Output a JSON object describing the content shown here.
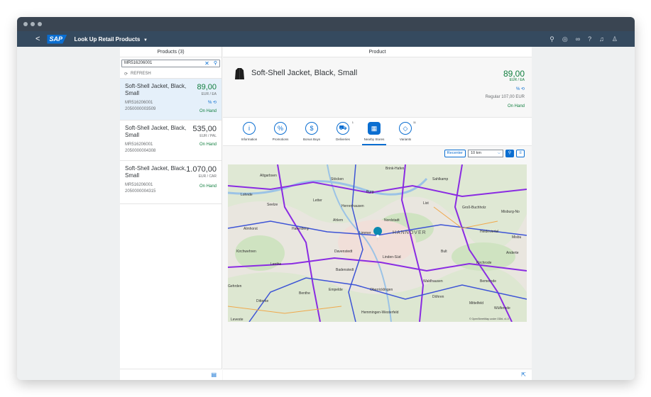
{
  "shell": {
    "back": "<",
    "logo": "SAP",
    "title": "Look Up Retail Products",
    "icons": [
      "search-icon",
      "target-icon",
      "binoculars-icon",
      "help-icon",
      "bell-icon",
      "user-icon"
    ]
  },
  "master": {
    "header": "Products (3)",
    "search_value": "MR516206001",
    "refresh": "REFRESH",
    "items": [
      {
        "name": "Soft-Shell Jacket, Black, Small",
        "price": "89,00",
        "unit": "EUR / EA",
        "sku": "MR516206001",
        "ean": "2050000003509",
        "status": "On Hand"
      },
      {
        "name": "Soft-Shell Jacket, Black, Small",
        "price": "535,00",
        "unit": "EUR / PAL",
        "sku": "MR516206001",
        "ean": "2050000004308",
        "status": "On Hand"
      },
      {
        "name": "Soft-Shell Jacket, Black, Small",
        "price": "1.070,00",
        "unit": "EUR / CAR",
        "sku": "MR516206001",
        "ean": "2050000004315",
        "status": "On Hand"
      }
    ]
  },
  "detail": {
    "header": "Product",
    "title": "Soft-Shell Jacket, Black, Small",
    "price": "89,00",
    "unit": "EUR / EA",
    "regular": "Regular 107,00 EUR",
    "status": "On Hand",
    "tabs": [
      {
        "label": "Information",
        "glyph": "i",
        "count": ""
      },
      {
        "label": "Promotions",
        "glyph": "%",
        "count": ""
      },
      {
        "label": "Bonus Buys",
        "glyph": "$",
        "count": ""
      },
      {
        "label": "Deliveries",
        "glyph": "⛟",
        "count": "1"
      },
      {
        "label": "Nearby Stores",
        "glyph": "▦",
        "count": ""
      },
      {
        "label": "Variants",
        "glyph": "◇",
        "count": "11"
      }
    ],
    "recenter": "Recenter",
    "distance": "10 km"
  },
  "map": {
    "labels": [
      "Brink-Hafen",
      "Altgarbsen",
      "Stöcken",
      "Sahlkamp",
      "Lohnde",
      "Burg",
      "Letter",
      "Seelze",
      "Herrenhausen",
      "List",
      "Groß-Buchholz",
      "Misburg-No",
      "Ahlem",
      "Nordstadt",
      "Almhorst",
      "Harenberg",
      "Limmer",
      "HANNOVER",
      "Heideviertel",
      "Misbu",
      "Kirchwehren",
      "Davenstedt",
      "Linden-Süd",
      "Bult",
      "Anderte",
      "Kirchrode",
      "Badenstedt",
      "Lenthe",
      "Waldhausen",
      "Bemerode",
      "Empelde",
      "Oberricklingen",
      "Gehrden",
      "Benthe",
      "Döhren",
      "Ditterke",
      "Mittelfeld",
      "Wülferode",
      "Hemmingen-Westerfeld",
      "Leveste"
    ],
    "attribution": "© OpenStreetMap under ODbL v1.0"
  }
}
